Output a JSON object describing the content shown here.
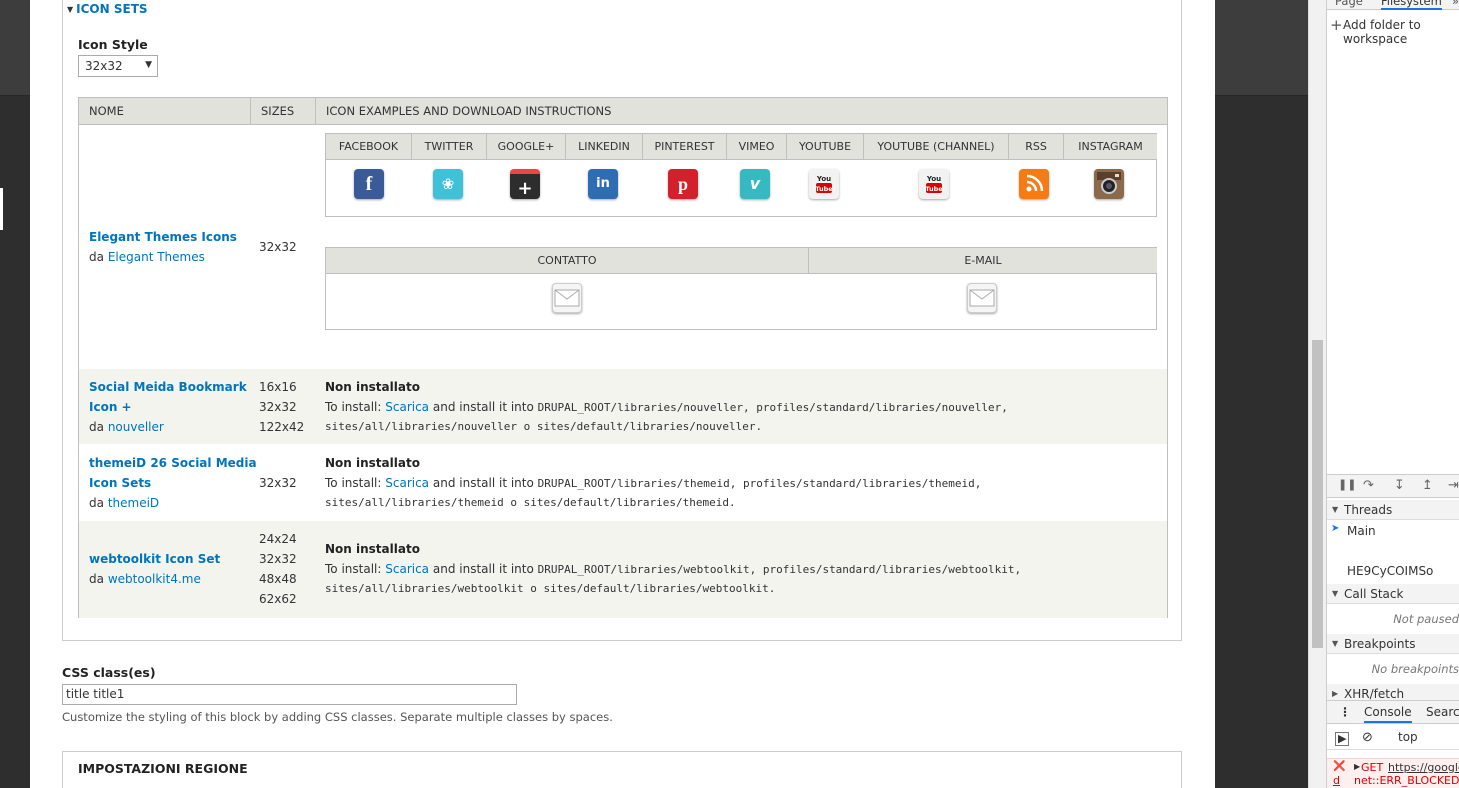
{
  "fieldset": {
    "title": "ICON SETS"
  },
  "icon_style": {
    "label": "Icon Style",
    "selected": "32x32"
  },
  "table": {
    "headers": [
      "NOME",
      "SIZES",
      "ICON EXAMPLES AND DOWNLOAD INSTRUCTIONS"
    ],
    "rows": [
      {
        "name": "Elegant Themes Icons",
        "by_prefix": "da",
        "by": "Elegant Themes",
        "sizes": [
          "32x32"
        ],
        "networks": [
          "FACEBOOK",
          "TWITTER",
          "GOOGLE+",
          "LINKEDIN",
          "PINTEREST",
          "VIMEO",
          "YOUTUBE",
          "YOUTUBE (CHANNEL)",
          "RSS",
          "INSTAGRAM"
        ],
        "contacts": [
          "CONTATTO",
          "E-MAIL"
        ]
      },
      {
        "name1": "Social Meida Bookmark",
        "name2": "Icon +",
        "by_prefix": "da",
        "by": "nouveller",
        "sizes": [
          "16x16",
          "32x32",
          "122x42"
        ],
        "status": "Non installato",
        "install_prefix": "To install:",
        "download": "Scarica",
        "install_mid": "and install it into",
        "path1": "DRUPAL_ROOT/libraries/nouveller, profiles/standard/libraries/nouveller,",
        "path2": "sites/all/libraries/nouveller o sites/default/libraries/nouveller."
      },
      {
        "name1": "themeiD 26 Social Media",
        "name2": "Icon Sets",
        "by_prefix": "da",
        "by": "themeiD",
        "sizes": [
          "32x32"
        ],
        "status": "Non installato",
        "install_prefix": "To install:",
        "download": "Scarica",
        "install_mid": "and install it into",
        "path1": "DRUPAL_ROOT/libraries/themeid, profiles/standard/libraries/themeid,",
        "path2": "sites/all/libraries/themeid o sites/default/libraries/themeid."
      },
      {
        "name": "webtoolkit Icon Set",
        "by_prefix": "da",
        "by": "webtoolkit4.me",
        "sizes": [
          "24x24",
          "32x32",
          "48x48",
          "62x62"
        ],
        "status": "Non installato",
        "install_prefix": "To install:",
        "download": "Scarica",
        "install_mid": "and install it into",
        "path1": "DRUPAL_ROOT/libraries/webtoolkit, profiles/standard/libraries/webtoolkit,",
        "path2": "sites/all/libraries/webtoolkit o sites/default/libraries/webtoolkit."
      }
    ]
  },
  "css_classes": {
    "label": "CSS class(es)",
    "value": "title title1",
    "description": "Customize the styling of this block by adding CSS classes. Separate multiple classes by spaces."
  },
  "region": {
    "title": "IMPOSTAZIONI REGIONE"
  },
  "devtools": {
    "tabs": [
      "Page",
      "Filesystem",
      "»"
    ],
    "add_folder": "Add folder to workspace",
    "threads_label": "Threads",
    "thread_main": "Main",
    "thread_worker": "HE9CyCOIMSo",
    "call_stack_label": "Call Stack",
    "not_paused": "Not paused",
    "breakpoints_label": "Breakpoints",
    "no_breakpoints": "No breakpoints",
    "xhr_label": "XHR/fetch Breakpoints",
    "console_tab": "Console",
    "search_tab": "Search",
    "context": "top",
    "error_method": "GET",
    "error_url": "https://googleads",
    "error_msg": "net::ERR_BLOCKED"
  },
  "colors": {
    "link": "#0074bd",
    "header_bg": "#e1e2dc",
    "alt_row": "#f3f4ee"
  }
}
